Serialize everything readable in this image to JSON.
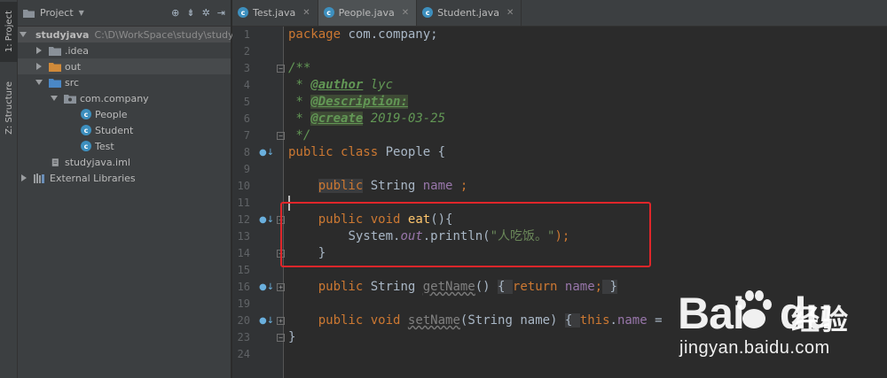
{
  "tool_windows": {
    "project_tab": "1: Project",
    "structure_tab": "Z: Structure"
  },
  "project_panel": {
    "title": "Project",
    "header_icons": [
      "globe-icon",
      "collapse-icon",
      "settings-icon",
      "hide-icon"
    ],
    "tree": [
      {
        "label": "studyjava",
        "path": "C:\\D\\WorkSpace\\study\\study",
        "icon": "module-folder-icon",
        "expanded": true
      },
      {
        "label": ".idea",
        "icon": "folder-icon",
        "expanded": false
      },
      {
        "label": "out",
        "icon": "orange-folder-icon",
        "expanded": false
      },
      {
        "label": "src",
        "icon": "source-folder-icon",
        "expanded": true
      },
      {
        "label": "com.company",
        "icon": "package-icon",
        "expanded": true
      },
      {
        "label": "People",
        "icon": "class-icon"
      },
      {
        "label": "Student",
        "icon": "class-icon"
      },
      {
        "label": "Test",
        "icon": "class-icon"
      },
      {
        "label": "studyjava.iml",
        "icon": "iml-file-icon"
      },
      {
        "label": "External Libraries",
        "icon": "libraries-icon",
        "expanded": false
      }
    ]
  },
  "editor": {
    "tabs": [
      {
        "label": "Test.java",
        "active": false
      },
      {
        "label": "People.java",
        "active": true
      },
      {
        "label": "Student.java",
        "active": false
      }
    ],
    "line_numbers": [
      "1",
      "2",
      "3",
      "4",
      "5",
      "6",
      "7",
      "8",
      "9",
      "10",
      "11",
      "12",
      "13",
      "14",
      "15",
      "16",
      "19",
      "20",
      "23",
      "24"
    ],
    "code": {
      "l1": {
        "kw": "package",
        "rest": " com.company;"
      },
      "l3": "/**",
      "l4": {
        "star": " * ",
        "tag": "@author",
        "val": " lyc"
      },
      "l5": {
        "star": " * ",
        "tag": "@Description:"
      },
      "l6": {
        "star": " * ",
        "tag": "@create",
        "val": " 2019-03-25"
      },
      "l7": " */",
      "l8": {
        "kw1": "public",
        "kw2": "class",
        "name": " People {"
      },
      "l10": {
        "kw": "public",
        "type": " String ",
        "field": "name",
        "end": " ;"
      },
      "l12": {
        "kw1": "public",
        "kw2": "void",
        "fn": "eat",
        "end": "(){"
      },
      "l13": {
        "pre": "System.",
        "fld": "out",
        "mid": ".println(",
        "str": "\"人吃饭。\"",
        "end": ");"
      },
      "l14": "}",
      "l16": {
        "kw": "public",
        "type": " String ",
        "fn": "getName",
        "paren": "()",
        "ob": "{ ",
        "ret": "return",
        "field": " name",
        "semi": ";",
        "cb": " }"
      },
      "l20": {
        "kw1": "public",
        "kw2": "void",
        "fn": "setName",
        "params": "(String name)",
        "ob": "{ ",
        "this": "this",
        "dot": ".",
        "field": "name",
        "eq": " = "
      },
      "l23": "}"
    }
  },
  "watermark": {
    "brand": "Bai",
    "brand2": "du",
    "jingyan": "经验",
    "url": "jingyan.baidu.com"
  }
}
